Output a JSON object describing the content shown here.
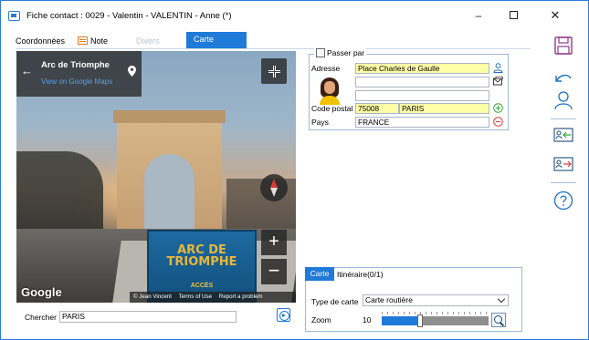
{
  "window": {
    "title": "Fiche contact : 0029 - Valentin - VALENTIN - Anne (*)",
    "minimize": "–",
    "close": "✕"
  },
  "tabs": [
    {
      "label": "Coordonnées"
    },
    {
      "label": "Note"
    },
    {
      "label": "Divers"
    },
    {
      "label": "Carte"
    }
  ],
  "map": {
    "place_name": "Arc de Triomphe",
    "view_link": "View on Google Maps",
    "back": "←",
    "zoom_in": "+",
    "zoom_out": "−",
    "logo": "Google",
    "sign_text": "ARC DE TRIOMPHE",
    "sign_sub": "ACCÈS",
    "footer": {
      "credit": "© Jean Vincent",
      "terms": "Terms of Use",
      "report": "Report a problem"
    }
  },
  "search": {
    "label": "Chercher",
    "value": "PARIS"
  },
  "address": {
    "passer_par": "Passer par",
    "adresse_label": "Adresse",
    "line1": "Place Charles de Gaulle",
    "line2": "",
    "line3": "",
    "code_postal_label": "Code postal",
    "code_postal": "75008",
    "ville": "PARIS",
    "pays_label": "Pays",
    "pays": "FRANCE"
  },
  "settings": {
    "tab_carte": "Carte",
    "tab_itineraire": "Itinéraire(0/1)",
    "type_label": "Type de carte",
    "type_value": "Carte routière",
    "zoom_label": "Zoom",
    "zoom_value": "10",
    "zoom_fraction": 0.36
  },
  "colors": {
    "accent": "#1f7ad8",
    "field_highlight": "#ffffa8",
    "add_green": "#3aa53a",
    "remove_red": "#d9413b"
  },
  "toolbar_icons": [
    "save-icon",
    "undo-icon",
    "user-icon",
    "import-contact-icon",
    "export-contact-icon",
    "help-icon"
  ]
}
